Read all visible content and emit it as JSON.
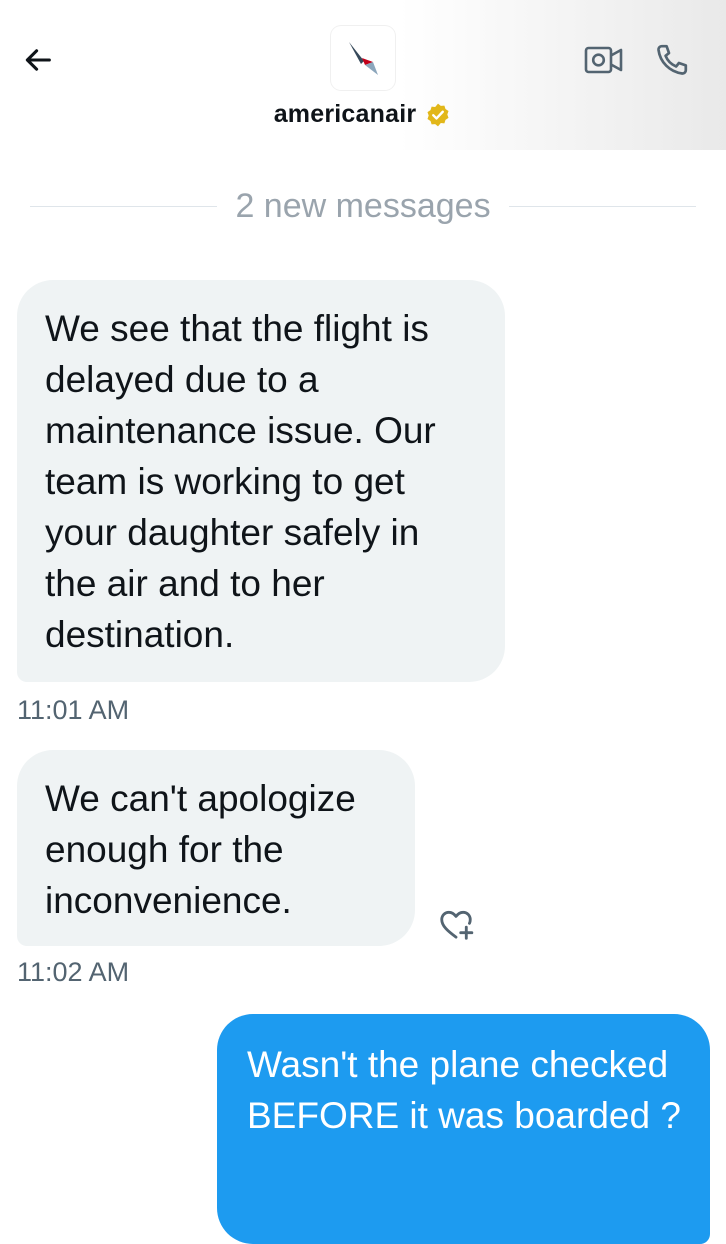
{
  "header": {
    "account_name": "americanair",
    "back_icon": "arrow-left-icon",
    "video_icon": "video-call-icon",
    "phone_icon": "phone-call-icon",
    "verified_icon": "verified-gold-badge-icon",
    "verified_color": "#e2b719"
  },
  "divider": {
    "label": "2 new messages"
  },
  "messages": [
    {
      "direction": "incoming",
      "text": "We see that the flight is delayed due to a maintenance issue. Our team is working to get your daughter safely in the air and to her destination.",
      "time": "11:01 AM"
    },
    {
      "direction": "incoming",
      "text": "We can't apologize enough for the inconvenience.",
      "time": "11:02 AM"
    },
    {
      "direction": "outgoing",
      "text": "Wasn't the plane checked BEFORE it was boarded ?"
    }
  ],
  "colors": {
    "incoming_bubble": "#eff3f4",
    "outgoing_bubble": "#1d9bf0",
    "secondary_text": "#536471",
    "divider_text": "#9aa4ad"
  }
}
